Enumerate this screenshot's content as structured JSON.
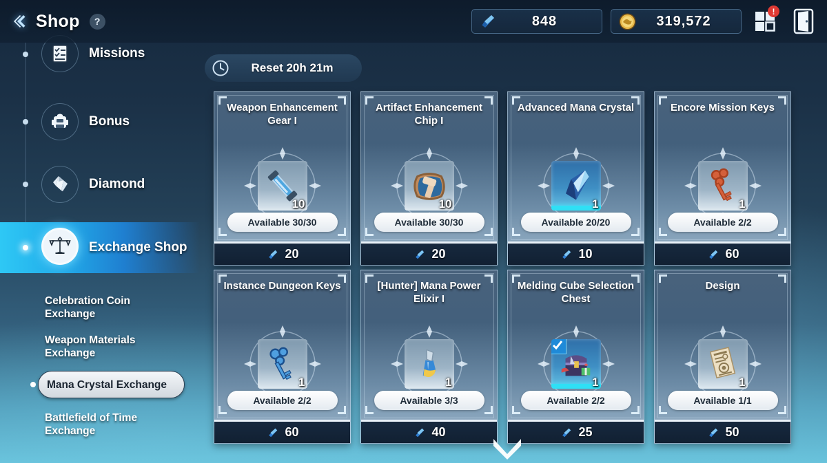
{
  "header": {
    "back_icon": "back-chevron-icon",
    "title": "Shop",
    "help_label": "?",
    "currencies": [
      {
        "icon": "mana-crystal-icon",
        "value": "848",
        "name": "mana-crystal"
      },
      {
        "icon": "gold-coin-icon",
        "value": "319,572",
        "name": "gold-coin"
      }
    ],
    "menu_icon": "menu-grid-icon",
    "menu_badge": "!",
    "exit_icon": "exit-door-icon"
  },
  "sidebar": {
    "items": [
      {
        "label": "Missions",
        "icon": "checklist-icon",
        "active": false
      },
      {
        "label": "Bonus",
        "icon": "backpack-icon",
        "active": false
      },
      {
        "label": "Diamond",
        "icon": "diamond-icon",
        "active": false
      },
      {
        "label": "Exchange Shop",
        "icon": "scales-icon",
        "active": true
      }
    ],
    "sub_items": [
      {
        "label": "Celebration Coin Exchange",
        "selected": false
      },
      {
        "label": "Weapon Materials Exchange",
        "selected": false
      },
      {
        "label": "Mana Crystal Exchange",
        "selected": true
      },
      {
        "label": "Battlefield of Time Exchange",
        "selected": false
      }
    ]
  },
  "reset": {
    "icon": "clock-icon",
    "text": "Reset 20h 21m"
  },
  "shop": {
    "currency_icon": "mana-crystal-icon",
    "items": [
      {
        "title": "Weapon Enhancement Gear I",
        "icon": "enhancement-gear-icon",
        "quantity": "10",
        "availability": "Available 30/30",
        "price": "20",
        "rare": false,
        "checked": false
      },
      {
        "title": "Artifact Enhancement Chip I",
        "icon": "hammer-chip-icon",
        "quantity": "10",
        "availability": "Available 30/30",
        "price": "20",
        "rare": false,
        "checked": false
      },
      {
        "title": "Advanced Mana Crystal",
        "icon": "mana-crystal-shard-icon",
        "quantity": "1",
        "availability": "Available 20/20",
        "price": "10",
        "rare": true,
        "checked": false
      },
      {
        "title": "Encore Mission Keys",
        "icon": "copper-key-icon",
        "quantity": "1",
        "availability": "Available 2/2",
        "price": "60",
        "rare": false,
        "checked": false
      },
      {
        "title": "Instance Dungeon Keys",
        "icon": "blue-key-icon",
        "quantity": "1",
        "availability": "Available 2/2",
        "price": "60",
        "rare": false,
        "checked": false
      },
      {
        "title": "[Hunter] Mana Power Elixir I",
        "icon": "potion-flask-icon",
        "quantity": "1",
        "availability": "Available 3/3",
        "price": "40",
        "rare": false,
        "checked": false
      },
      {
        "title": "Melding Cube Selection Chest",
        "icon": "treasure-chest-icon",
        "quantity": "1",
        "availability": "Available 2/2",
        "price": "25",
        "rare": true,
        "checked": true
      },
      {
        "title": "Design",
        "icon": "blueprint-icon",
        "quantity": "1",
        "availability": "Available 1/1",
        "price": "50",
        "rare": false,
        "checked": false
      }
    ]
  },
  "scroll": {
    "icon": "chevron-down-icon"
  },
  "colors": {
    "accent_cyan": "#2ec8f5",
    "accent_blue": "#1f7fd0",
    "badge_red": "#e03a34",
    "rarity_cyan": "#2fe0f5",
    "gold": "#e3b23c"
  }
}
